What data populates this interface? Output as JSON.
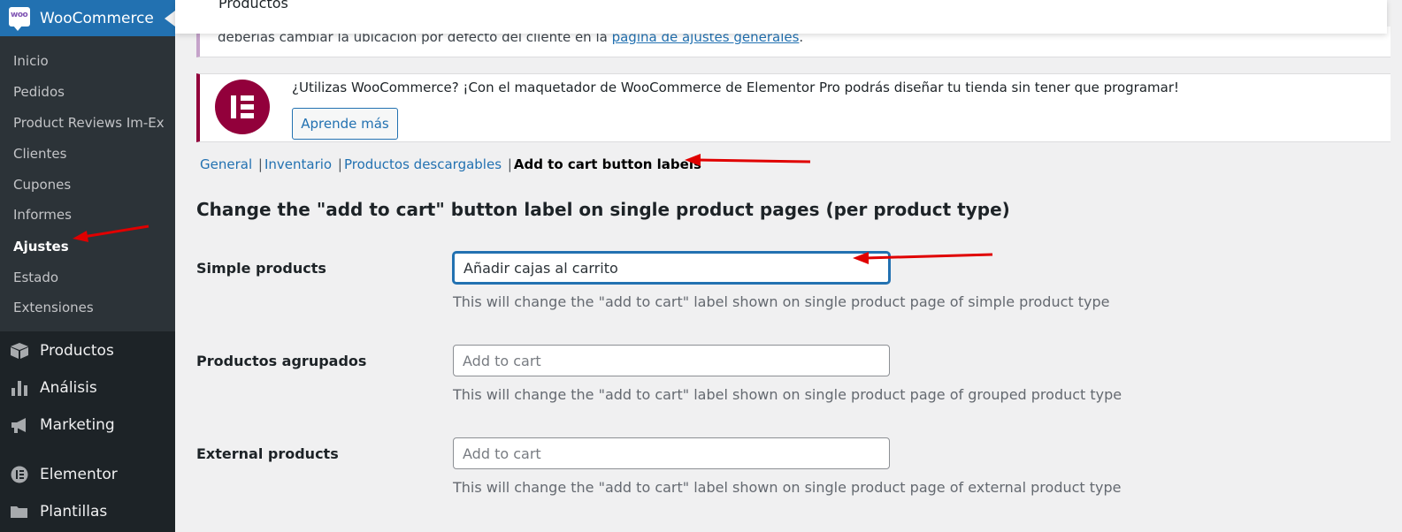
{
  "sidebar": {
    "header_title": "WooCommerce",
    "logo_text": "woo",
    "submenu": [
      "Inicio",
      "Pedidos",
      "Product Reviews Im-Ex",
      "Clientes",
      "Cupones",
      "Informes",
      "Ajustes",
      "Estado",
      "Extensiones"
    ],
    "active_item": "Ajustes",
    "menu": [
      {
        "label": "Productos",
        "icon": "box-icon"
      },
      {
        "label": "Análisis",
        "icon": "bar-chart-icon"
      },
      {
        "label": "Marketing",
        "icon": "megaphone-icon"
      },
      {
        "label": "Elementor",
        "icon": "elementor-icon"
      },
      {
        "label": "Plantillas",
        "icon": "folder-icon"
      }
    ]
  },
  "topbar": {
    "title": "Productos"
  },
  "notice_location": {
    "text_before": "deberías cambiar la ubicación por defecto del cliente en la ",
    "link": "página de ajustes generales",
    "text_after": "."
  },
  "notice_elementor": {
    "text": "¿Utilizas WooCommerce? ¡Con el maquetador de WooCommerce de Elementor Pro podrás diseñar tu tienda sin tener que programar!",
    "button": "Aprende más"
  },
  "subnav": {
    "links": [
      "General",
      "Inventario",
      "Productos descargables"
    ],
    "current": "Add to cart button labels"
  },
  "section_title": "Change the \"add to cart\" button label on single product pages (per product type)",
  "fields": [
    {
      "label": "Simple products",
      "value": "Añadir cajas al carrito",
      "placeholder": "",
      "description": "This will change the \"add to cart\" label shown on single product page of simple product type"
    },
    {
      "label": "Productos agrupados",
      "value": "",
      "placeholder": "Add to cart",
      "description": "This will change the \"add to cart\" label shown on single product page of grouped product type"
    },
    {
      "label": "External products",
      "value": "",
      "placeholder": "Add to cart",
      "description": "This will change the \"add to cart\" label shown on single product page of external product type"
    }
  ],
  "colors": {
    "sidebar_bg": "#1d2327",
    "submenu_bg": "#2c3338",
    "wp_blue": "#2271b1",
    "elementor_red": "#92003b",
    "annotation_arrow": "#e00000"
  }
}
